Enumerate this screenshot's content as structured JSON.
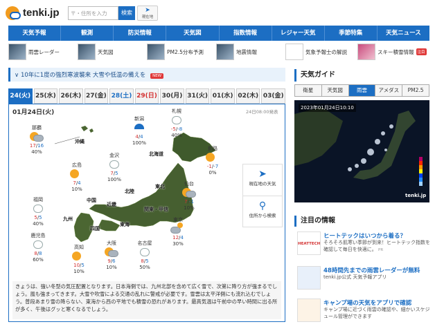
{
  "header": {
    "logo_text": "tenki.jp",
    "search_placeholder": "〒・住所を入力",
    "search_button": "検索",
    "location_button": "現在地"
  },
  "nav": [
    "天気予報",
    "観測",
    "防災情報",
    "天気図",
    "指数情報",
    "レジャー天気",
    "季節特集",
    "天気ニュース"
  ],
  "quick_links": [
    {
      "label": "雨雲レーダー"
    },
    {
      "label": "天気図"
    },
    {
      "label": "PM2.5分布予測"
    },
    {
      "label": "地震情報"
    },
    {
      "label": "気象予報士の解説"
    },
    {
      "label": "スキー積雪情報",
      "badge": "注目"
    }
  ],
  "alert": {
    "text": "10年に1度の強烈寒波襲来 大雪や低温の備えを",
    "badge": "NEW"
  },
  "date_tabs": [
    {
      "label": "24(火)",
      "kind": "active"
    },
    {
      "label": "25(水)",
      "kind": "normal"
    },
    {
      "label": "26(木)",
      "kind": "normal"
    },
    {
      "label": "27(金)",
      "kind": "normal"
    },
    {
      "label": "28(土)",
      "kind": "sat"
    },
    {
      "label": "29(日)",
      "kind": "sun"
    },
    {
      "label": "30(月)",
      "kind": "normal"
    },
    {
      "label": "31(火)",
      "kind": "normal"
    },
    {
      "label": "01(水)",
      "kind": "normal"
    },
    {
      "label": "02(木)",
      "kind": "normal"
    },
    {
      "label": "03(金)",
      "kind": "normal"
    }
  ],
  "map": {
    "date": "01月24日(火)",
    "issued": "24日08:00発表",
    "cities": {
      "naha": {
        "name": "那覇",
        "hi": "17",
        "lo": "16",
        "pop": "40%",
        "wx": "sun-cloud"
      },
      "niigata": {
        "name": "新潟",
        "hi": "4",
        "lo": "4",
        "pop": "100%",
        "wx": "snow-umbrella"
      },
      "sapporo": {
        "name": "札幌",
        "hi": "-5",
        "lo": "-8",
        "pop": "40%",
        "wx": "snow"
      },
      "kanazawa": {
        "name": "金沢",
        "hi": "7",
        "lo": "5",
        "pop": "100%",
        "wx": "snow-umbrella"
      },
      "kushiro": {
        "name": "釧路",
        "hi": "-1",
        "lo": "-7",
        "pop": "0%",
        "wx": "sun"
      },
      "hiroshima": {
        "name": "広島",
        "hi": "7",
        "lo": "4",
        "pop": "10%",
        "wx": "sun"
      },
      "sendai": {
        "name": "仙台",
        "hi": "7",
        "lo": "-1",
        "pop": "10%",
        "wx": "sun-cloud"
      },
      "fukuoka": {
        "name": "福岡",
        "hi": "5",
        "lo": "5",
        "pop": "40%",
        "wx": "snow"
      },
      "tokyo": {
        "name": "東京",
        "hi": "12",
        "lo": "4",
        "pop": "30%",
        "wx": "cloud-sun"
      },
      "kagoshima": {
        "name": "鹿児島",
        "hi": "8",
        "lo": "8",
        "pop": "60%",
        "wx": "snow"
      },
      "kochi": {
        "name": "高知",
        "hi": "10",
        "lo": "5",
        "pop": "10%",
        "wx": "sun"
      },
      "osaka": {
        "name": "大阪",
        "hi": "9",
        "lo": "6",
        "pop": "10%",
        "wx": "sun-cloud"
      },
      "nagoya": {
        "name": "名古屋",
        "hi": "8",
        "lo": "5",
        "pop": "50%",
        "wx": "snow"
      }
    },
    "regions": {
      "okinawa": "沖縄",
      "hokkaido": "北海道",
      "tohoku": "東北",
      "hokuriku": "北陸",
      "chugoku": "中国",
      "kinki": "近畿",
      "kanto": "関東・甲信",
      "kyushu": "九州",
      "shikoku": "四国",
      "tokai": "東海"
    },
    "side_buttons": {
      "current": "現在地の天気",
      "address": "住所から検索"
    },
    "summary": "きょうは、強い冬型の気圧配置となります。日本海側では、九州北部を含めて広く雪で、次第に降り方が強まるでしょう。風も強まってきます。大雪や吹雪による交通の乱れに警戒が必要です。雪雲は太平洋側にも流れ込むでしょう。普段あまり雪の降らない、東海から西の平地でも積雪の恐れがあります。最高気温は午前中の早い時間に出る所が多く、午後はグッと寒くなるでしょう。"
  },
  "guide": {
    "title": "天気ガイド",
    "tabs": [
      {
        "label": "衛星",
        "active": false
      },
      {
        "label": "天気図",
        "active": false
      },
      {
        "label": "雨雲",
        "active": true
      },
      {
        "label": "アメダス",
        "active": false
      },
      {
        "label": "PM2.5",
        "active": false
      }
    ],
    "timestamp": "2023年01月24日10:10",
    "watermark": "tenki.jp"
  },
  "news": {
    "title": "注目の情報",
    "items": [
      {
        "headline": "ヒートテックはいつから着る？",
        "body": "そろそろ肌寒い季節が到来！ヒートテック指数を確認して毎日を快適に。",
        "pr": "PR",
        "thumb": "HEATTECH"
      },
      {
        "headline": "48時間先までの雨雲レーダーが無料",
        "body": "tenki.jp公式 天気予報アプリ",
        "pr": "",
        "thumb": "app"
      },
      {
        "headline": "キャンプ場の天気をアプリで確認",
        "body": "キャンプ場に近づく雨雲の確認や、細かいスケジュール管理ができます",
        "pr": "",
        "thumb": "camp"
      }
    ]
  },
  "colors": {
    "brand": "#1c6ec3",
    "hot": "#d32f2f",
    "alert_badge": "#e03a3a",
    "sun": "#f5a623"
  }
}
